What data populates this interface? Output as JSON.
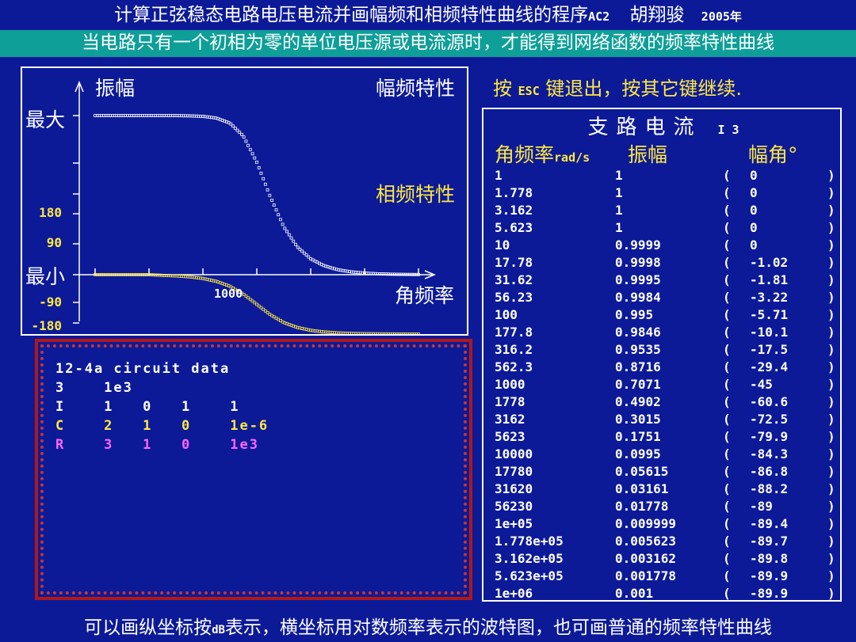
{
  "header": {
    "title_prefix": "计算正弦稳态电路电压电流并画幅频和相频特性曲线的程序",
    "title_code": "AC2",
    "title_author": "胡翔骏",
    "title_year": "2005年",
    "subtitle": "当电路只有一个初相为零的单位电压源或电流源时，才能得到网络函数的频率特性曲线"
  },
  "plot": {
    "y_axis_label": "振幅",
    "amp_title": "幅频特性",
    "phase_title": "相频特性",
    "max_label": "最大",
    "min_label": "最小",
    "x_axis_label": "角频率",
    "x_tick_label": "1000",
    "phase_ticks": [
      "180",
      "90",
      "-90",
      "-180"
    ],
    "colors": {
      "amplitude": "#ffffff",
      "phase": "#ffe840",
      "axis": "#ffffff"
    }
  },
  "instruction": {
    "prefix": "按",
    "key": "ESC",
    "suffix": "键退出，按其它键继续."
  },
  "circuit": {
    "lines": [
      {
        "text": "12-4a circuit data",
        "color": "#ffffff"
      },
      {
        "text": "3    1e3",
        "color": "#ffffff"
      },
      {
        "text": "I    1   0   1    1",
        "color": "#ffffff"
      },
      {
        "text": "C    2   1   0    1e-6",
        "color": "#ffe840"
      },
      {
        "text": "R    3   1   0    1e3",
        "color": "#ff66ff"
      }
    ]
  },
  "table": {
    "heading": "支路电流",
    "heading_id": "I  3",
    "col_freq": "角频率",
    "col_freq_unit": "rad/s",
    "col_mag": "振幅",
    "col_angle": "幅角°",
    "rows": [
      [
        "1",
        "1",
        "0"
      ],
      [
        "1.778",
        "1",
        "0"
      ],
      [
        "3.162",
        "1",
        "0"
      ],
      [
        "5.623",
        "1",
        "0"
      ],
      [
        "10",
        "0.9999",
        "0"
      ],
      [
        "17.78",
        "0.9998",
        "-1.02"
      ],
      [
        "31.62",
        "0.9995",
        "-1.81"
      ],
      [
        "56.23",
        "0.9984",
        "-3.22"
      ],
      [
        "100",
        "0.995",
        "-5.71"
      ],
      [
        "177.8",
        "0.9846",
        "-10.1"
      ],
      [
        "316.2",
        "0.9535",
        "-17.5"
      ],
      [
        "562.3",
        "0.8716",
        "-29.4"
      ],
      [
        "1000",
        "0.7071",
        "-45"
      ],
      [
        "1778",
        "0.4902",
        "-60.6"
      ],
      [
        "3162",
        "0.3015",
        "-72.5"
      ],
      [
        "5623",
        "0.1751",
        "-79.9"
      ],
      [
        "10000",
        "0.0995",
        "-84.3"
      ],
      [
        "17780",
        "0.05615",
        "-86.8"
      ],
      [
        "31620",
        "0.03161",
        "-88.2"
      ],
      [
        "56230",
        "0.01778",
        "-89"
      ],
      [
        "1e+05",
        "0.009999",
        "-89.4"
      ],
      [
        "1.778e+05",
        "0.005623",
        "-89.7"
      ],
      [
        "3.162e+05",
        "0.003162",
        "-89.8"
      ],
      [
        "5.623e+05",
        "0.001778",
        "-89.9"
      ],
      [
        "1e+06",
        "0.001",
        "-89.9"
      ]
    ],
    "paren_open": "(",
    "paren_close": ")"
  },
  "footer": {
    "text_a": "可以画纵坐标按",
    "text_db": "dB",
    "text_b": "表示，横坐标用对数频率表示的波特图，也可画普通的频率特性曲线"
  },
  "chart_data": {
    "type": "line",
    "x_scale": "log",
    "x": [
      1,
      1.778,
      3.162,
      5.623,
      10,
      17.78,
      31.62,
      56.23,
      100,
      177.8,
      316.2,
      562.3,
      1000,
      1778,
      3162,
      5623,
      10000,
      17780,
      31620,
      56230,
      100000,
      177800,
      316200,
      562300,
      1000000
    ],
    "series": [
      {
        "values": [
          1,
          1,
          1,
          1,
          0.9999,
          0.9998,
          0.9995,
          0.9984,
          0.995,
          0.9846,
          0.9535,
          0.8716,
          0.7071,
          0.4902,
          0.3015,
          0.1751,
          0.0995,
          0.05615,
          0.03161,
          0.01778,
          0.009999,
          0.005623,
          0.003162,
          0.001778,
          0.001
        ]
      },
      {
        "values": [
          0,
          0,
          0,
          0,
          0,
          -1.02,
          -1.81,
          -3.22,
          -5.71,
          -10.1,
          -17.5,
          -29.4,
          -45,
          -60.6,
          -72.5,
          -79.9,
          -84.3,
          -86.8,
          -88.2,
          -89,
          -89.4,
          -89.7,
          -89.8,
          -89.9,
          -89.9
        ]
      }
    ],
    "xlabel": "角频率",
    "ylabel": "振幅",
    "phase_ylim": [
      -180,
      180
    ]
  }
}
